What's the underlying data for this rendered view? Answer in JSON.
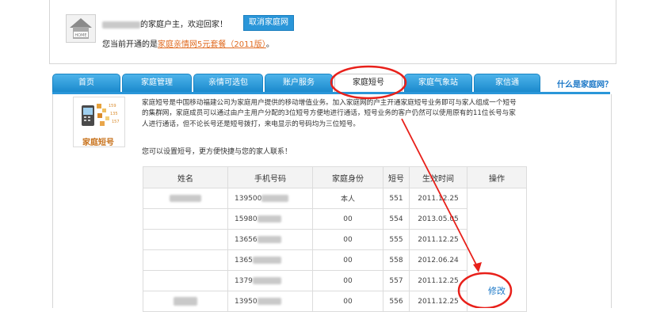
{
  "header": {
    "welcome_suffix": "的家庭户主，欢迎回家！",
    "logout_label": "取消家庭网",
    "plan_prefix": "您当前开通的是",
    "plan_name": "家庭亲情网5元套餐（2011版）",
    "plan_suffix": "。",
    "home_icon_text": "HOME"
  },
  "tabs": [
    {
      "label": "首页"
    },
    {
      "label": "家庭管理"
    },
    {
      "label": "亲情可选包"
    },
    {
      "label": "账户服务"
    },
    {
      "label": "家庭短号"
    },
    {
      "label": "家庭气象站"
    },
    {
      "label": "家信通"
    }
  ],
  "help_link": "什么是家庭网？",
  "service": {
    "logo_caption": "家庭短号",
    "description": "家庭短号是中国移动福建公司为家庭用户提供的移动增值业务。加入家庭网的户主开通家庭短号业务即可与家人组成一个短号的集群网，家庭成员可以通过由户主用户分配的3位短号方便地进行通话，短号业务的客户仍然可以使用原有的11位长号与家人进行通话，但不论长号还是短号拨打，来电显示的号码均为三位短号。",
    "invite_text": "您可以设置短号，更方便快捷与您的家人联系！"
  },
  "table": {
    "headers": [
      "姓名",
      "手机号码",
      "家庭身份",
      "短号",
      "生效时间",
      "操作"
    ],
    "rows": [
      {
        "phone": "139500",
        "role": "本人",
        "short": "551",
        "date": "2011.12.25"
      },
      {
        "phone": "15980",
        "role": "00",
        "short": "554",
        "date": "2013.05.05"
      },
      {
        "phone": "13656",
        "role": "00",
        "short": "555",
        "date": "2011.12.25"
      },
      {
        "phone": "1365",
        "role": "00",
        "short": "558",
        "date": "2012.06.24"
      },
      {
        "phone": "1379",
        "role": "00",
        "short": "557",
        "date": "2011.12.25"
      },
      {
        "phone": "13950",
        "role": "00",
        "short": "556",
        "date": "2011.12.25"
      }
    ],
    "edit_label": "修改"
  },
  "colors": {
    "tab_blue": "#1b8acd",
    "link_blue": "#1a77c7",
    "plan_orange": "#e06a1f",
    "annotation_red": "#e8201a"
  }
}
